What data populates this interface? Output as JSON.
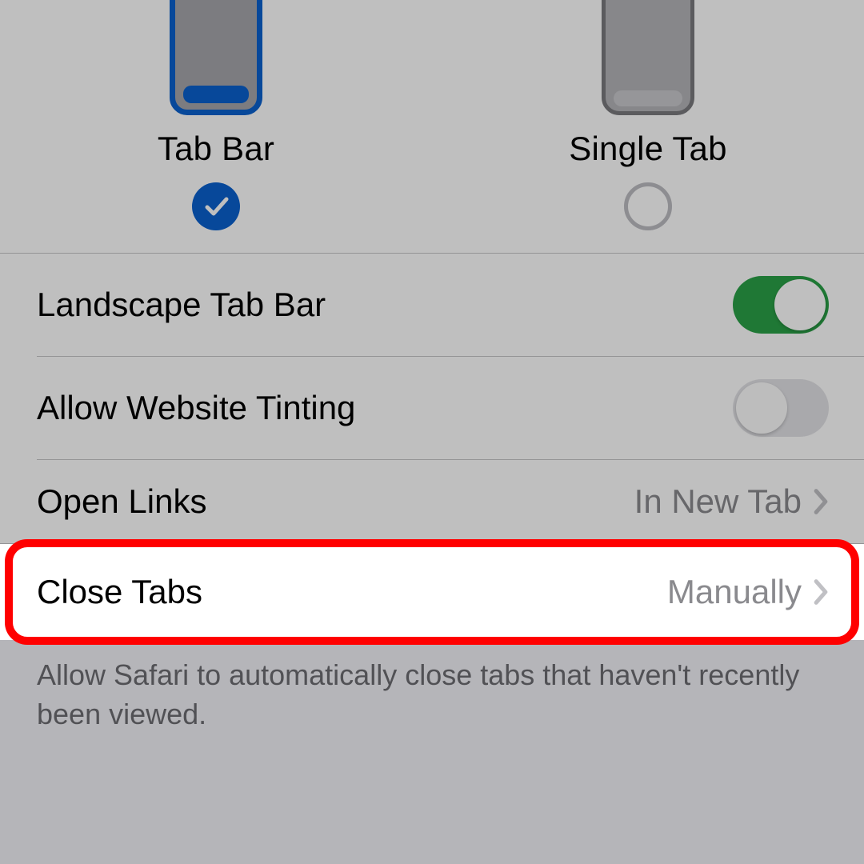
{
  "layout_options": {
    "tab_bar": {
      "label": "Tab Bar",
      "selected": true
    },
    "single_tab": {
      "label": "Single Tab",
      "selected": false
    }
  },
  "rows": {
    "landscape_tab_bar": {
      "label": "Landscape Tab Bar",
      "on": true
    },
    "allow_website_tinting": {
      "label": "Allow Website Tinting",
      "on": false
    },
    "open_links": {
      "label": "Open Links",
      "value": "In New Tab"
    },
    "close_tabs": {
      "label": "Close Tabs",
      "value": "Manually"
    }
  },
  "footer": "Allow Safari to automatically close tabs that haven't recently been viewed.",
  "colors": {
    "accent": "#0a60ce",
    "toggle_on": "#2aa147",
    "highlight": "#ff0000"
  }
}
